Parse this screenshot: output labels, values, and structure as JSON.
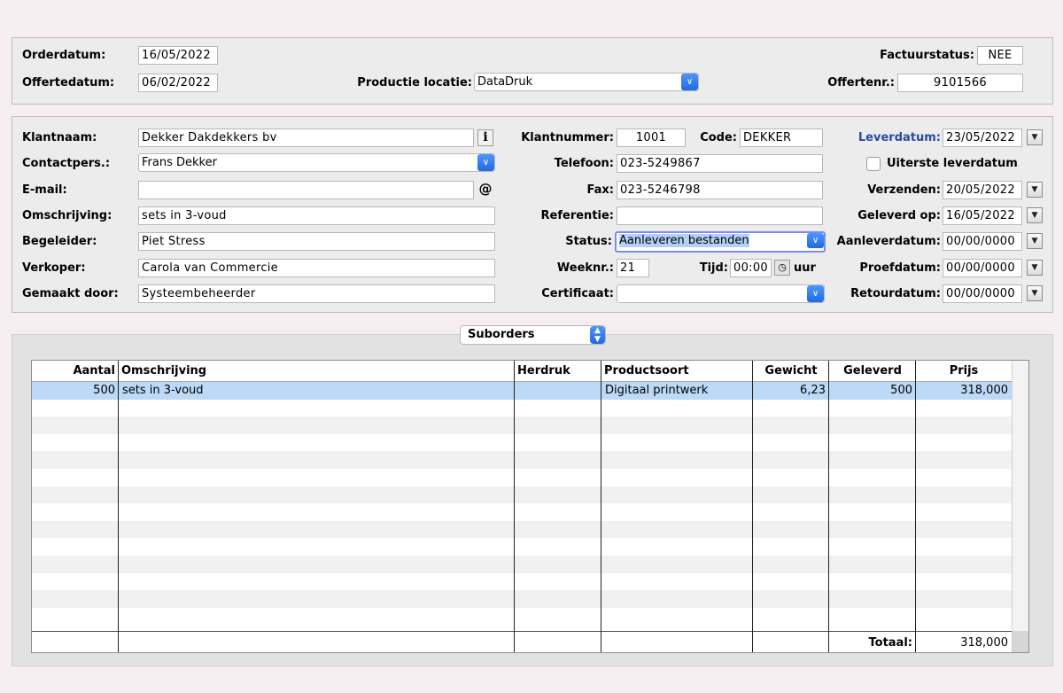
{
  "top": {
    "orderdatum_label": "Orderdatum:",
    "orderdatum_value": "16/05/2022",
    "offertedatum_label": "Offertedatum:",
    "offertedatum_value": "06/02/2022",
    "productie_label": "Productie locatie:",
    "productie_value": "DataDruk",
    "factuurstatus_label": "Factuurstatus:",
    "factuurstatus_value": "NEE",
    "offertenr_label": "Offertenr.:",
    "offertenr_value": "9101566"
  },
  "customer": {
    "klantnaam_label": "Klantnaam:",
    "klantnaam_value": "Dekker Dakdekkers bv",
    "contact_label": "Contactpers.:",
    "contact_value": "Frans Dekker",
    "email_label": "E-mail:",
    "email_value": "",
    "omschrijving_label": "Omschrijving:",
    "omschrijving_value": "sets in 3-voud",
    "begeleider_label": "Begeleider:",
    "begeleider_value": "Piet Stress",
    "verkoper_label": "Verkoper:",
    "verkoper_value": "Carola van Commercie",
    "gemaakt_label": "Gemaakt door:",
    "gemaakt_value": "Systeembeheerder",
    "info_glyph": "i",
    "email_glyph": "@"
  },
  "middle": {
    "klantnummer_label": "Klantnummer:",
    "klantnummer_value": "1001",
    "code_label": "Code:",
    "code_value": "DEKKER",
    "telefoon_label": "Telefoon:",
    "telefoon_value": "023-5249867",
    "fax_label": "Fax:",
    "fax_value": "023-5246798",
    "referentie_label": "Referentie:",
    "referentie_value": "",
    "status_label": "Status:",
    "status_value": "Aanleveren bestanden",
    "weeknr_label": "Weeknr.:",
    "weeknr_value": "21",
    "tijd_label": "Tijd:",
    "tijd_value": "00:00",
    "uur_label": "uur",
    "certificaat_label": "Certificaat:",
    "certificaat_value": ""
  },
  "dates": {
    "leverdatum_label": "Leverdatum:",
    "leverdatum_value": "23/05/2022",
    "uiterste_label": "Uiterste leverdatum",
    "uiterste_checked": false,
    "verzenden_label": "Verzenden:",
    "verzenden_value": "20/05/2022",
    "geleverd_label": "Geleverd op:",
    "geleverd_value": "16/05/2022",
    "aanlever_label": "Aanleverdatum:",
    "aanlever_value": "00/00/0000",
    "proef_label": "Proefdatum:",
    "proef_value": "00/00/0000",
    "retour_label": "Retourdatum:",
    "retour_value": "00/00/0000"
  },
  "suborders": {
    "popup_label": "Suborders",
    "columns": [
      "Aantal",
      "Omschrijving",
      "Herdruk",
      "Productsoort",
      "Gewicht",
      "Geleverd",
      "Prijs"
    ],
    "rows": [
      {
        "aantal": "500",
        "omschrijving": "sets in 3-voud",
        "herdruk": "",
        "productsoort": "Digitaal printwerk",
        "gewicht": "6,23",
        "geleverd": "500",
        "prijs": "318,000"
      }
    ],
    "totaal_label": "Totaal:",
    "totaal_value": "318,000"
  },
  "colors": {
    "selection": "#bcd9f7",
    "accent": "#1f6ae6",
    "leverdatum_label": "#2a4aa0"
  }
}
